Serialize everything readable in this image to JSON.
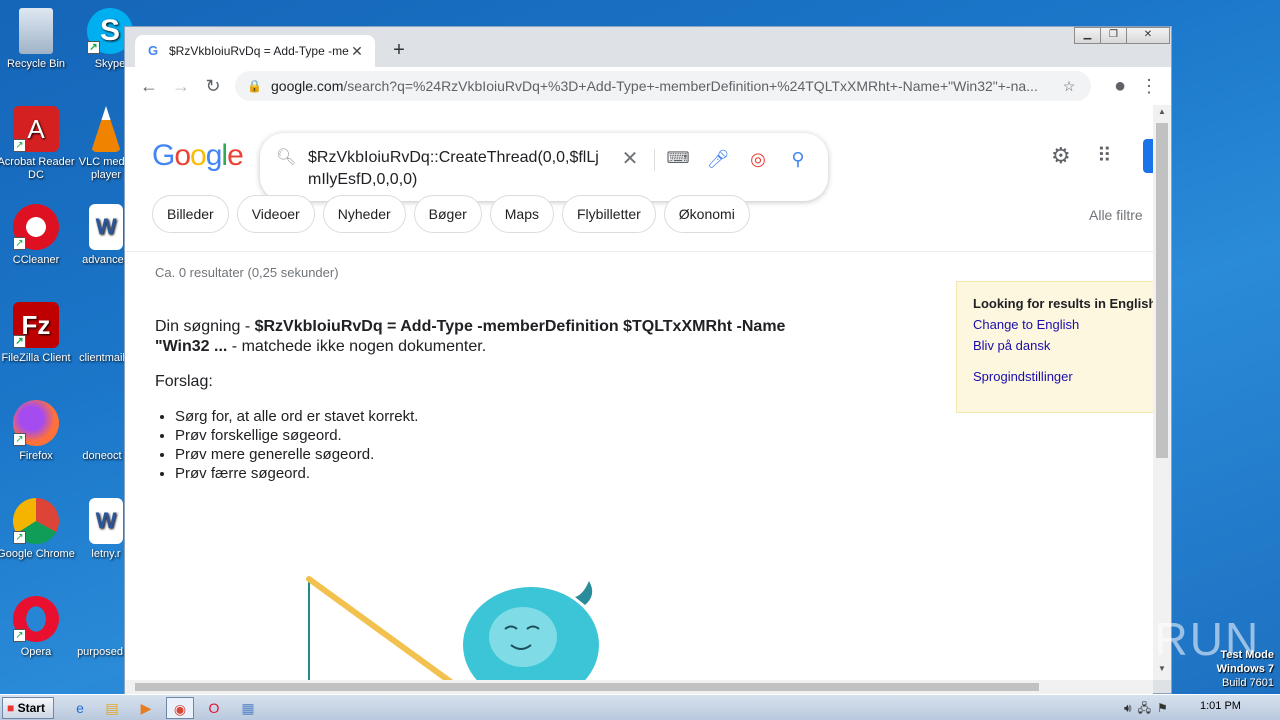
{
  "desktop": {
    "icons": [
      {
        "label": "Recycle Bin"
      },
      {
        "label": "Skype"
      },
      {
        "label": "Acrobat Reader DC"
      },
      {
        "label": "VLC media player"
      },
      {
        "label": "CCleaner"
      },
      {
        "label": "advanced"
      },
      {
        "label": "FileZilla Client"
      },
      {
        "label": "clientmail"
      },
      {
        "label": "Firefox"
      },
      {
        "label": "doneoct"
      },
      {
        "label": "Google Chrome"
      },
      {
        "label": "letny.r"
      },
      {
        "label": "Opera"
      },
      {
        "label": "purposed"
      }
    ]
  },
  "browser": {
    "tab_title": "$RzVkbIoiuRvDq = Add-Type -memb",
    "url_host": "google.com",
    "url_rest": "/search?q=%24RzVkbIoiuRvDq+%3D+Add-Type+-memberDefinition+%24TQLTxXMRht+-Name+\"Win32\"+-na..."
  },
  "google": {
    "logo": [
      "G",
      "o",
      "o",
      "g",
      "l",
      "e"
    ],
    "query": "$RzVkbIoiuRvDq::CreateThread(0,0,$flLjmIlyEsfD,0,0,0)",
    "chips": [
      "Billeder",
      "Videoer",
      "Nyheder",
      "Bøger",
      "Maps",
      "Flybilletter",
      "Økonomi"
    ],
    "all_filters": "Alle filtre",
    "stats": "Ca. 0 resultater (0,25 sekunder)",
    "no_results_prefix": "Din søgning - ",
    "no_results_query": "$RzVkbIoiuRvDq = Add-Type -memberDefinition $TQLTxXMRht -Name \"Win32 ...",
    "no_results_suffix": " - matchede ikke nogen dokumenter.",
    "suggestions_heading": "Forslag:",
    "suggestions": [
      "Sørg for, at alle ord er stavet korrekt.",
      "Prøv forskellige søgeord.",
      "Prøv mere generelle søgeord.",
      "Prøv færre søgeord."
    ],
    "lang_box": {
      "heading": "Looking for results in English",
      "change": "Change to English",
      "stay": "Bliv på dansk",
      "settings": "Sprogindstillinger"
    }
  },
  "taskbar": {
    "start": "Start",
    "clock": "1:01 PM"
  },
  "overlay": {
    "watermark": "ANY RUN",
    "test_mode": "Test Mode",
    "os": "Windows 7",
    "build": "Build 7601"
  }
}
